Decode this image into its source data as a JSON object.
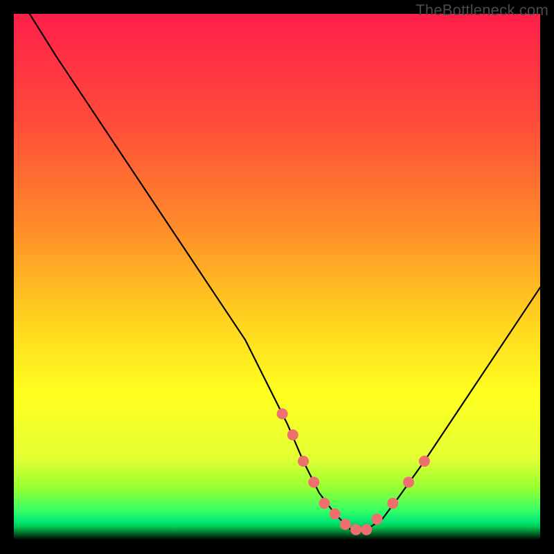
{
  "watermark": "TheBottleneck.com",
  "chart_data": {
    "type": "line",
    "title": "",
    "xlabel": "",
    "ylabel": "",
    "xlim": [
      0,
      100
    ],
    "ylim": [
      0,
      100
    ],
    "curve": {
      "name": "bottleneck-curve",
      "x": [
        3,
        8,
        14,
        20,
        26,
        32,
        38,
        44,
        48,
        52,
        55,
        58,
        61,
        64,
        67,
        70,
        73,
        78,
        84,
        90,
        96,
        100
      ],
      "y": [
        100,
        92,
        83,
        74,
        65,
        56,
        47,
        38,
        30,
        22,
        15,
        9,
        5,
        2,
        2,
        4,
        8,
        15,
        24,
        33,
        42,
        48
      ]
    },
    "markers": {
      "name": "highlight-dots",
      "x": [
        51,
        53,
        55,
        57,
        59,
        61,
        63,
        65,
        67,
        69,
        72,
        75,
        78
      ],
      "y": [
        24,
        20,
        15,
        11,
        7,
        5,
        3,
        2,
        2,
        4,
        7,
        11,
        15
      ]
    },
    "gradient_stops": [
      {
        "offset": 0.0,
        "color": "#ff1f4b"
      },
      {
        "offset": 0.2,
        "color": "#ff4a3a"
      },
      {
        "offset": 0.4,
        "color": "#ff8a2a"
      },
      {
        "offset": 0.58,
        "color": "#ffd21f"
      },
      {
        "offset": 0.72,
        "color": "#ffff1f"
      },
      {
        "offset": 0.84,
        "color": "#e6ff33"
      },
      {
        "offset": 0.9,
        "color": "#99ff33"
      },
      {
        "offset": 0.945,
        "color": "#33ff66"
      },
      {
        "offset": 0.965,
        "color": "#00e676"
      },
      {
        "offset": 0.975,
        "color": "#00c853"
      },
      {
        "offset": 1.0,
        "color": "#000000"
      }
    ],
    "marker_color": "#ef6f6f",
    "curve_color": "#000000"
  }
}
